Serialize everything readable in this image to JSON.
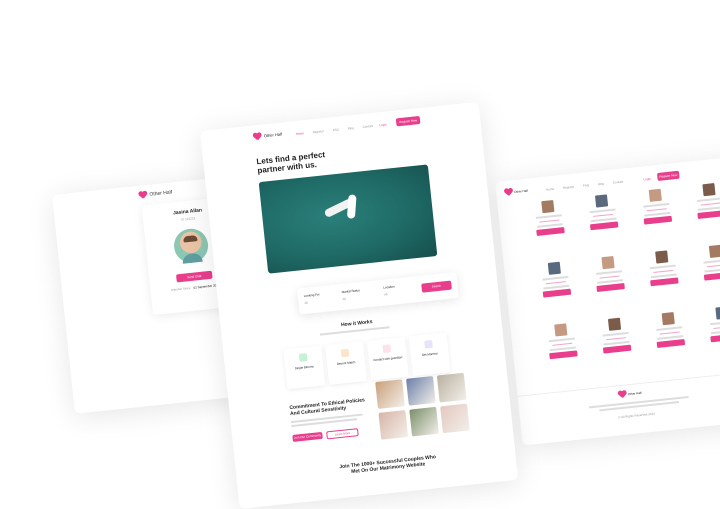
{
  "left_card": {
    "logo_text": "Other Half",
    "name": "Jasina Allan",
    "id_text": "ID 123213",
    "button_label": "Send Chat",
    "member_since_label": "Member Since",
    "member_since_value": "02 September 2020"
  },
  "center_card": {
    "logo_text": "Other Half",
    "nav_items": [
      "Home",
      "Register",
      "FAQ",
      "Blog",
      "Contact"
    ],
    "login_label": "Login",
    "register_label": "Register Now",
    "hero_title": "Lets find a perfect partner with us.",
    "search": {
      "looking_for_label": "Looking For",
      "looking_for_value": "All",
      "marital_status_label": "Marital Status",
      "marital_status_value": "All",
      "location_label": "Location",
      "location_value": "All",
      "button_label": "Search"
    },
    "how_it_works_title": "How it Works",
    "steps": [
      {
        "title": "Single Blooms",
        "color": "#c8f0d4"
      },
      {
        "title": "Decent Match",
        "color": "#fde4cf"
      },
      {
        "title": "Contact with guardian",
        "color": "#fde1ec"
      },
      {
        "title": "Get Married",
        "color": "#e6e4fb"
      }
    ],
    "commitment_title": "Commitment To Ethical Policies And Cultural Sensitivity",
    "commitment_btn_primary": "Join Our Community",
    "commitment_btn_secondary": "Learn More",
    "bottom_title": "Join The 1000+ Successful Couples Who Met On Our Matrimony Website"
  },
  "right_card": {
    "logo_text": "Other Half",
    "nav_items": [
      "Home",
      "Register",
      "FAQ",
      "Blog",
      "Contact"
    ],
    "login_label": "Login",
    "register_label": "Register Now",
    "footer_logo_text": "Other Half",
    "copyright": "© All Rights Reserved 2024"
  },
  "colors": {
    "accent": "#e83e8c",
    "hero_water": "#1f6a66"
  }
}
